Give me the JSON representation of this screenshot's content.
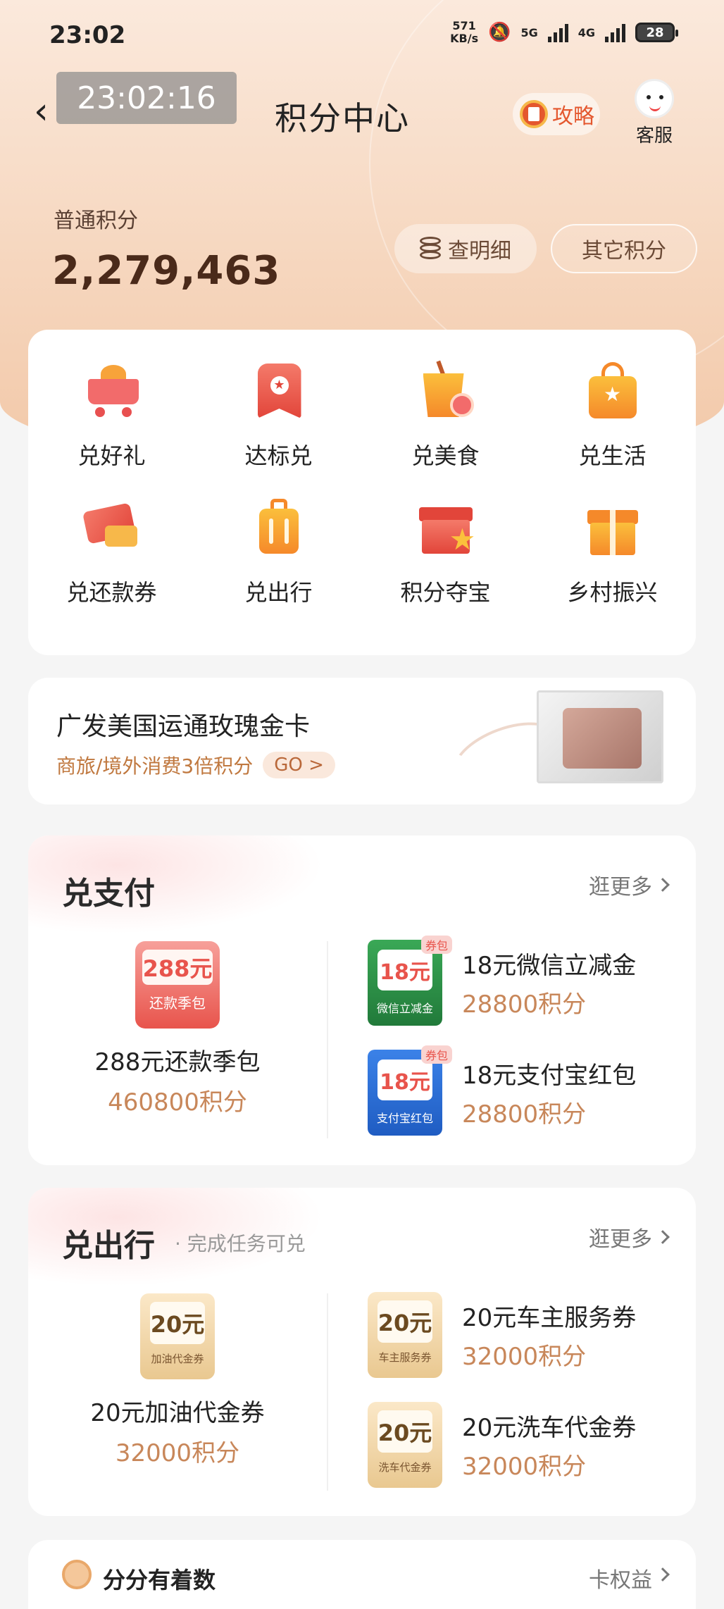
{
  "status_bar": {
    "time": "23:02",
    "net_speed_value": "571",
    "net_speed_unit": "KB/s",
    "net1": "5G",
    "net2": "4G",
    "battery": "28"
  },
  "header": {
    "time_overlay": "23:02:16",
    "title": "积分中心",
    "guide_label": "攻略",
    "service_label": "客服"
  },
  "points": {
    "label": "普通积分",
    "value": "2,279,463",
    "detail_button": "查明细",
    "other_button": "其它积分"
  },
  "categories": [
    {
      "label": "兑好礼",
      "icon": "shopping-cart-icon"
    },
    {
      "label": "达标兑",
      "icon": "badge-star-icon"
    },
    {
      "label": "兑美食",
      "icon": "drink-cup-icon"
    },
    {
      "label": "兑生活",
      "icon": "shopping-bag-icon"
    },
    {
      "label": "兑还款券",
      "icon": "ticket-card-icon"
    },
    {
      "label": "兑出行",
      "icon": "luggage-icon"
    },
    {
      "label": "积分夺宝",
      "icon": "treasure-box-icon"
    },
    {
      "label": "乡村振兴",
      "icon": "gift-box-icon"
    }
  ],
  "banner": {
    "title": "广发美国运通玫瑰金卡",
    "subtitle": "商旅/境外消费3倍积分",
    "go_label": "GO >"
  },
  "pay_section": {
    "title": "兑支付",
    "more_label": "逛更多",
    "big_item": {
      "thumb_amount": "288元",
      "thumb_caption": "还款季包",
      "name": "288元还款季包",
      "price": "460800积分"
    },
    "items": [
      {
        "thumb_amount": "18元",
        "thumb_caption": "微信立减金",
        "tag": "券包",
        "name": "18元微信立减金",
        "price": "28800积分"
      },
      {
        "thumb_amount": "18元",
        "thumb_caption": "支付宝红包",
        "tag": "券包",
        "name": "18元支付宝红包",
        "price": "28800积分"
      }
    ]
  },
  "travel_section": {
    "title": "兑出行",
    "subtitle": "· 完成任务可兑",
    "more_label": "逛更多",
    "big_item": {
      "thumb_amount": "20元",
      "thumb_caption": "加油代金券",
      "name": "20元加油代金券",
      "price": "32000积分"
    },
    "items": [
      {
        "thumb_amount": "20元",
        "thumb_caption": "车主服务券",
        "name": "20元车主服务券",
        "price": "32000积分"
      },
      {
        "thumb_amount": "20元",
        "thumb_caption": "洗车代金券",
        "name": "20元洗车代金券",
        "price": "32000积分"
      }
    ]
  },
  "bottom": {
    "title": "分分有着数",
    "more_label": "卡权益"
  }
}
